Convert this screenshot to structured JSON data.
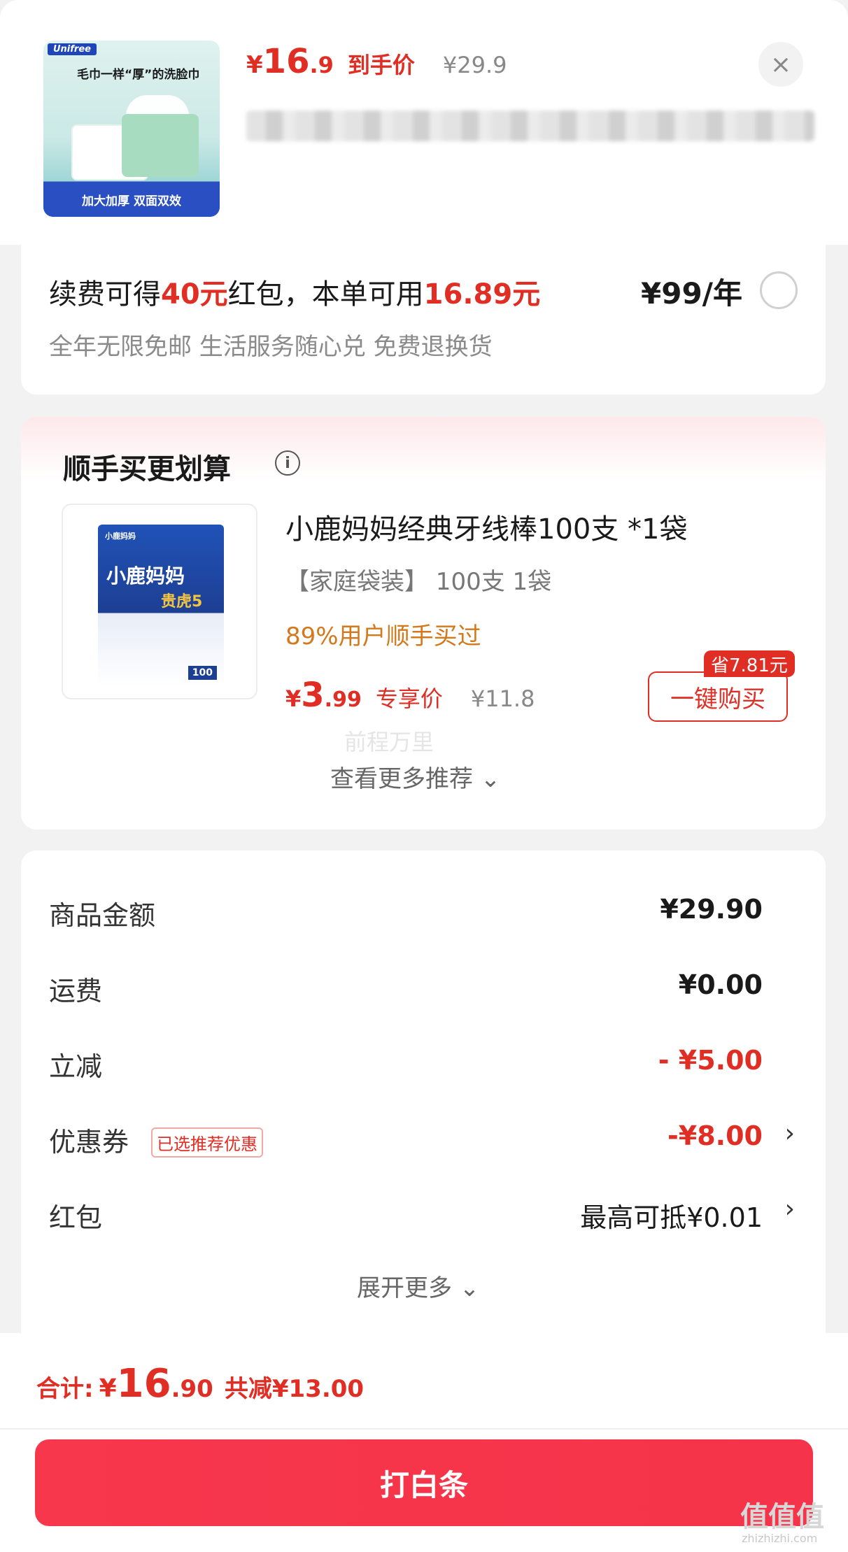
{
  "product": {
    "thumb_brand": "Unifree",
    "thumb_slogan": "毛巾一样“厚”的洗脸巾",
    "thumb_banner": "加大加厚 双面双效",
    "price_symbol": "¥",
    "price_int": "16",
    "price_dec": ".9",
    "price_tag": "到手价",
    "original_price": "¥29.9",
    "close_glyph": "×"
  },
  "membership": {
    "line1_a": "续费可得",
    "line1_b": "40元",
    "line1_c": "红包，本单可用",
    "line1_d": "16.89元",
    "benefits": "全年无限免邮 生活服务随心兑 免费退换货",
    "price": "¥99/年"
  },
  "recommend": {
    "title": "顺手买更划算",
    "info_glyph": "i",
    "img_brand": "小鹿妈妈",
    "img_name": "小鹿妈妈",
    "img_series": "贵虎5",
    "img_count": "100",
    "name": "小鹿妈妈经典牙线棒100支 *1袋",
    "spec": "【家庭袋装】 100支 1袋",
    "stat": "89%用户顺手买过",
    "price_symbol": "¥",
    "price_int": "3",
    "price_dec": ".99",
    "price_tag": "专享价",
    "original_price": "¥11.8",
    "save_badge": "省7.81元",
    "buy_label": "一键购买",
    "watermark": "前程万里",
    "more_label": "查看更多推荐 ⌄"
  },
  "summary": {
    "rows": [
      {
        "label": "商品金额",
        "value": "¥29.90"
      },
      {
        "label": "运费",
        "value": "¥0.00"
      },
      {
        "label": "立减",
        "value": "- ¥5.00"
      },
      {
        "label": "优惠券",
        "tag": "已选推荐优惠",
        "value": "-¥8.00"
      },
      {
        "label": "红包",
        "value": "最高可抵¥0.01"
      }
    ],
    "chevron": "›",
    "expand_label": "展开更多 ⌄"
  },
  "footer": {
    "total_label": "合计:",
    "total_symbol": "¥",
    "total_int": "16",
    "total_dec": ".90",
    "total_saved": "共减¥13.00",
    "pay_label": "打白条",
    "site_mark": "值值值",
    "site_url": "zhizhizhi.com"
  },
  "colors": {
    "accent_red": "#e02e24",
    "pay_button": "#f5334a",
    "stat_orange": "#d3791b"
  }
}
